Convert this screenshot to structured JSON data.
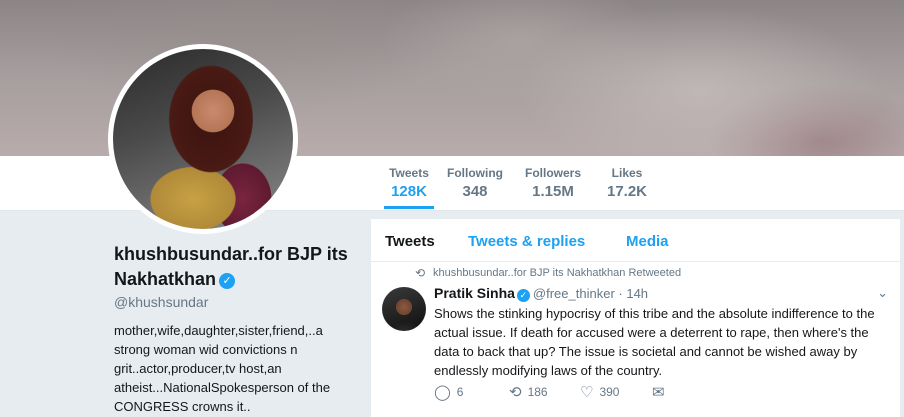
{
  "profile": {
    "name": "khushbusundar..for BJP its Nakhatkhan",
    "handle": "@khushsundar",
    "bio": "mother,wife,daughter,sister,friend,..a strong woman wid convictions n grit..actor,producer,tv host,an atheist...NationalSpokesperson of the CONGRESS crowns it.."
  },
  "stats": [
    {
      "label": "Tweets",
      "value": "128K"
    },
    {
      "label": "Following",
      "value": "348"
    },
    {
      "label": "Followers",
      "value": "1.15M"
    },
    {
      "label": "Likes",
      "value": "17.2K"
    }
  ],
  "tabs": [
    {
      "label": "Tweets"
    },
    {
      "label": "Tweets & replies"
    },
    {
      "label": "Media"
    }
  ],
  "tweet": {
    "retweet_note": "khushbusundar..for BJP its Nakhatkhan Retweeted",
    "author_name": "Pratik Sinha",
    "author_handle": "@free_thinker",
    "time": "· 14h",
    "text": "Shows the stinking hypocrisy of this tribe and the absolute indifference to the actual issue. If death for accused were a deterrent to rape, then where's the data to back that up? The issue is societal and cannot be wished away by endlessly modifying laws of the country.",
    "replies": "6",
    "retweets": "186",
    "likes": "390"
  },
  "icons": {
    "verified": "verified-badge-icon",
    "retweet": "retweet-icon",
    "reply": "reply-icon",
    "like": "heart-icon",
    "message": "envelope-icon",
    "caret": "chevron-down-icon"
  },
  "colors": {
    "accent": "#1da1f2",
    "muted": "#657786",
    "text": "#14171a",
    "page_bg": "#e6ecf0"
  }
}
